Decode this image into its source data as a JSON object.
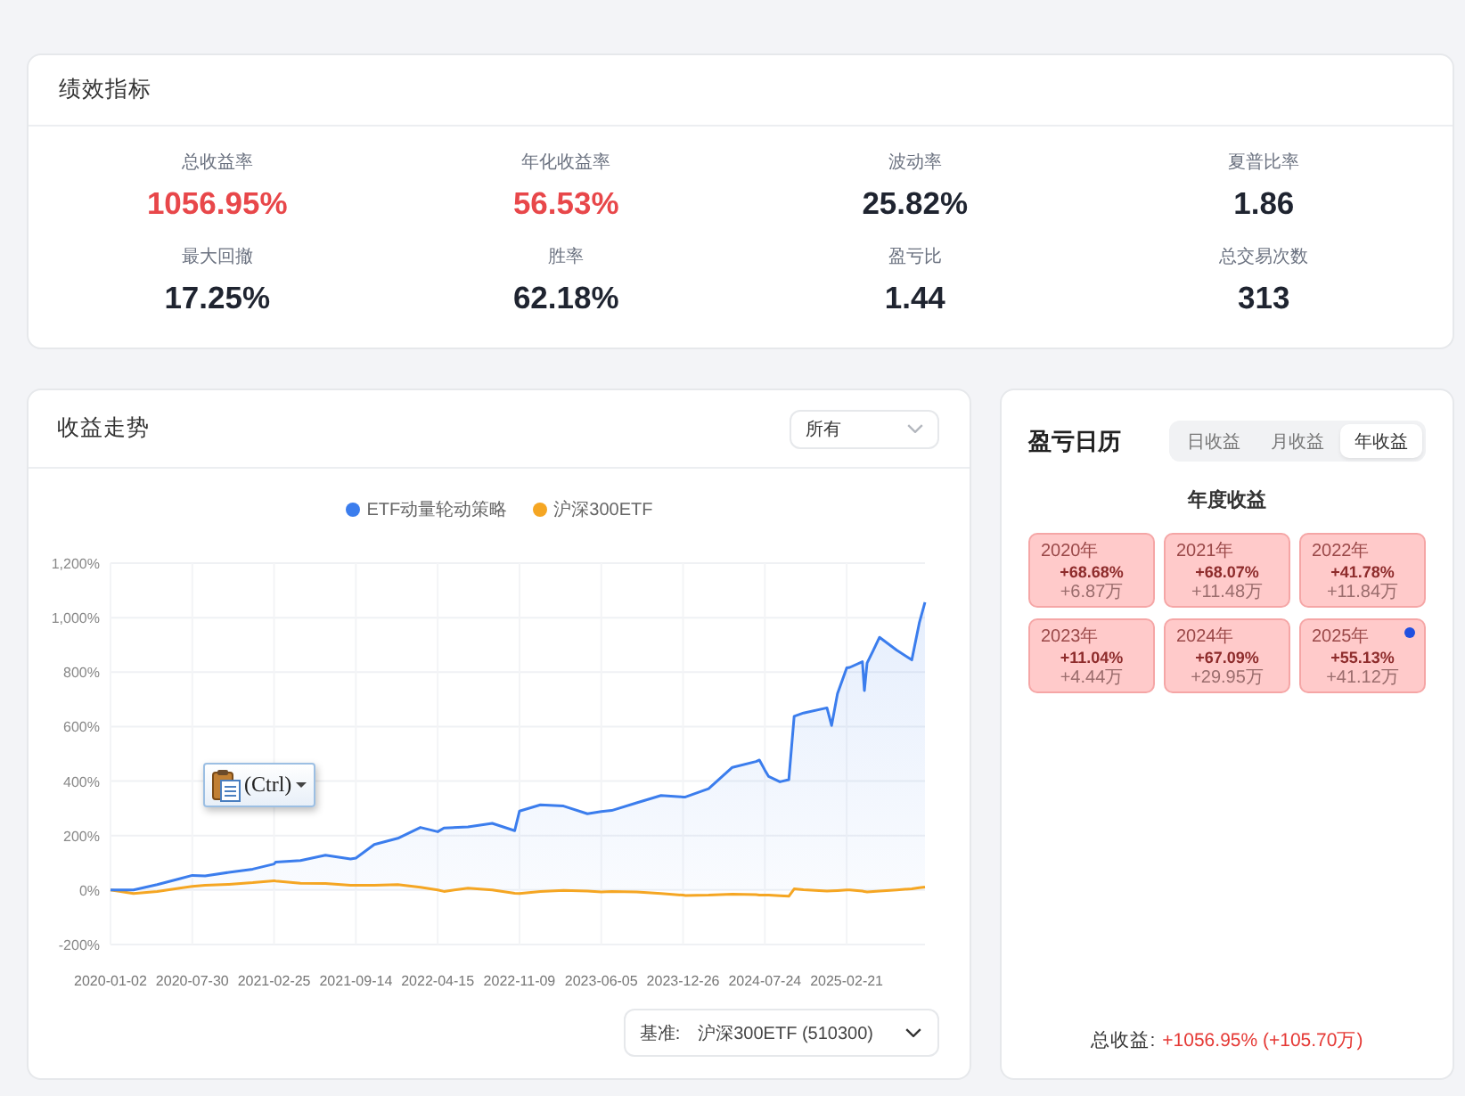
{
  "metrics_card": {
    "title": "绩效指标",
    "metrics": [
      {
        "label": "总收益率",
        "value": "1056.95%",
        "color": "#e8474a"
      },
      {
        "label": "年化收益率",
        "value": "56.53%",
        "color": "#e8474a"
      },
      {
        "label": "波动率",
        "value": "25.82%",
        "color": "#1f2430"
      },
      {
        "label": "夏普比率",
        "value": "1.86",
        "color": "#1f2430"
      },
      {
        "label": "最大回撤",
        "value": "17.25%",
        "color": "#1f2430"
      },
      {
        "label": "胜率",
        "value": "62.18%",
        "color": "#1f2430"
      },
      {
        "label": "盈亏比",
        "value": "1.44",
        "color": "#1f2430"
      },
      {
        "label": "总交易次数",
        "value": "313",
        "color": "#1f2430"
      }
    ]
  },
  "trend_card": {
    "title": "收益走势",
    "range_select": {
      "value": "所有"
    },
    "chart_data": {
      "type": "line",
      "legend": true,
      "grid": true,
      "x": [
        "2020-01-02",
        "2020-03-01",
        "2020-05-01",
        "2020-07-01",
        "2020-07-30",
        "2020-09-01",
        "2020-11-01",
        "2021-01-01",
        "2021-02-25",
        "2021-03-01",
        "2021-05-01",
        "2021-07-01",
        "2021-09-01",
        "2021-09-14",
        "2021-11-01",
        "2022-01-01",
        "2022-03-01",
        "2022-04-15",
        "2022-05-01",
        "2022-07-01",
        "2022-09-01",
        "2022-10-28",
        "2022-11-09",
        "2023-01-01",
        "2023-03-01",
        "2023-05-01",
        "2023-06-05",
        "2023-07-01",
        "2023-09-01",
        "2023-11-01",
        "2023-12-26",
        "2024-01-01",
        "2024-03-01",
        "2024-05-01",
        "2024-07-01",
        "2024-07-10",
        "2024-07-24",
        "2024-08-03",
        "2024-09-01",
        "2024-09-24",
        "2024-10-08",
        "2024-11-01",
        "2025-01-01",
        "2025-01-13",
        "2025-01-28",
        "2025-02-21",
        "2025-03-01",
        "2025-04-03",
        "2025-04-08",
        "2025-04-15",
        "2025-05-01",
        "2025-05-17",
        "2025-07-01",
        "2025-08-09",
        "2025-08-28",
        "2025-09-12"
      ],
      "series": [
        {
          "name": "ETF动量轮动策略",
          "color": "#3b7ded",
          "type": "area",
          "values": [
            0,
            0,
            20,
            43,
            54,
            52,
            65,
            77,
            96,
            103,
            108,
            128,
            114,
            117,
            167,
            190,
            230,
            214,
            228,
            232,
            245,
            218,
            290,
            313,
            308,
            280,
            288,
            292,
            320,
            347,
            342,
            342,
            372,
            450,
            472,
            477,
            440,
            417,
            397,
            405,
            638,
            650,
            669,
            604,
            721,
            815,
            817,
            838,
            732,
            833,
            880,
            928,
            880,
            845,
            980,
            1057
          ]
        },
        {
          "name": "沪深300ETF",
          "color": "#f5a623",
          "values": [
            0,
            -13,
            -6,
            8,
            13,
            17,
            21,
            27,
            34,
            33,
            25,
            24,
            18,
            18,
            18,
            20,
            10,
            0,
            -5,
            7,
            0,
            -12,
            -13,
            -5,
            -1,
            -4,
            -7,
            -6,
            -7,
            -13,
            -19,
            -20,
            -19,
            -15,
            -17,
            -18,
            -18,
            -19,
            -21,
            -23,
            4,
            1,
            -4,
            -3,
            -2,
            0,
            0,
            -4,
            -6,
            -7,
            -5,
            -4,
            0,
            5,
            9,
            11
          ]
        }
      ],
      "xlim": [
        "2020-01-02",
        "2025-09-12"
      ],
      "ylim": [
        -200,
        1200
      ],
      "xticks": [
        "2020-01-02",
        "2020-07-30",
        "2021-02-25",
        "2021-09-14",
        "2022-04-15",
        "2022-11-09",
        "2023-06-05",
        "2023-12-26",
        "2024-07-24",
        "2025-02-21"
      ],
      "yticks": [
        {
          "value": -200,
          "label": "-200%"
        },
        {
          "value": 0,
          "label": "0%"
        },
        {
          "value": 200,
          "label": "200%"
        },
        {
          "value": 400,
          "label": "400%"
        },
        {
          "value": 600,
          "label": "600%"
        },
        {
          "value": 800,
          "label": "800%"
        },
        {
          "value": 1000,
          "label": "1,000%"
        },
        {
          "value": 1200,
          "label": "1,200%"
        }
      ]
    },
    "paste_options": {
      "label": "(Ctrl)"
    },
    "benchmark_select": {
      "label": "基准:",
      "value": "沪深300ETF (510300)"
    }
  },
  "calendar_card": {
    "title": "盈亏日历",
    "tabs": [
      {
        "label": "日收益",
        "selected": false
      },
      {
        "label": "月收益",
        "selected": false
      },
      {
        "label": "年收益",
        "selected": true
      }
    ],
    "subtitle": "年度收益",
    "years": [
      {
        "year": "2020年",
        "return": "+68.68%",
        "amount": "+6.87万",
        "current": false
      },
      {
        "year": "2021年",
        "return": "+68.07%",
        "amount": "+11.48万",
        "current": false
      },
      {
        "year": "2022年",
        "return": "+41.78%",
        "amount": "+11.84万",
        "current": false
      },
      {
        "year": "2023年",
        "return": "+11.04%",
        "amount": "+4.44万",
        "current": false
      },
      {
        "year": "2024年",
        "return": "+67.09%",
        "amount": "+29.95万",
        "current": false
      },
      {
        "year": "2025年",
        "return": "+55.13%",
        "amount": "+41.12万",
        "current": true
      }
    ],
    "total": {
      "label": "总收益:",
      "value": "+1056.95% (+105.70万)"
    }
  }
}
